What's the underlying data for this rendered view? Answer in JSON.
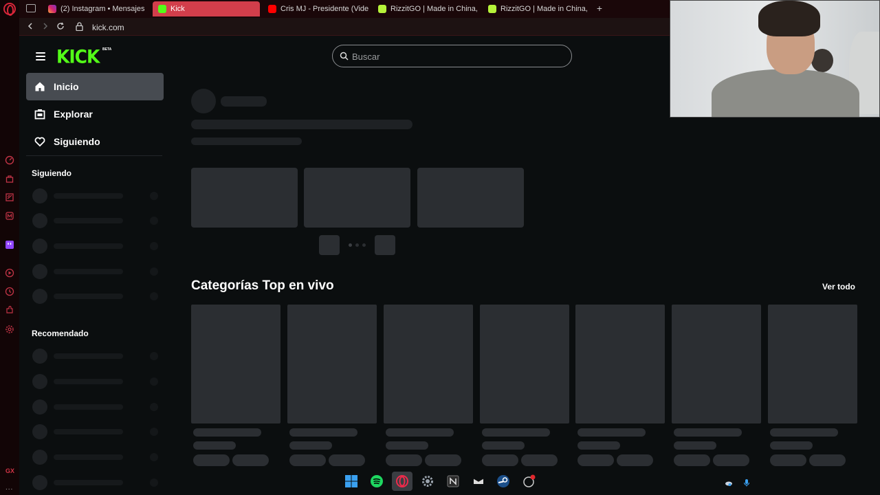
{
  "browser": {
    "tabs": [
      {
        "title": "(2) Instagram • Mensajes",
        "favicon": "instagram-icon"
      },
      {
        "title": "Kick",
        "favicon": "kick-icon",
        "active": true
      },
      {
        "title": "Cris MJ - Presidente (Vide",
        "favicon": "youtube-icon"
      },
      {
        "title": "RizzitGO | Made in China,",
        "favicon": "rizzitgo-icon"
      },
      {
        "title": "RizzitGO | Made in China,",
        "favicon": "rizzitgo-icon"
      }
    ],
    "new_tab": "+",
    "url": "kick.com",
    "side_label": "GX",
    "side_more": "..."
  },
  "header": {
    "logo": "KICK",
    "logo_badge": "BETA",
    "search_placeholder": "Buscar"
  },
  "sidebar": {
    "nav": [
      {
        "label": "Inicio",
        "icon": "home-icon",
        "active": true
      },
      {
        "label": "Explorar",
        "icon": "explore-icon"
      },
      {
        "label": "Siguiendo",
        "icon": "heart-icon"
      }
    ],
    "following_heading": "Siguiendo",
    "recommended_heading": "Recomendado"
  },
  "main": {
    "categories_title": "Categorías Top en vivo",
    "see_all": "Ver todo"
  },
  "colors": {
    "accent": "#53fc18",
    "background": "#0b0e0f",
    "skeleton": "#2b2e32",
    "active_nav": "#474b51",
    "browser_accent": "#d23e4b"
  }
}
